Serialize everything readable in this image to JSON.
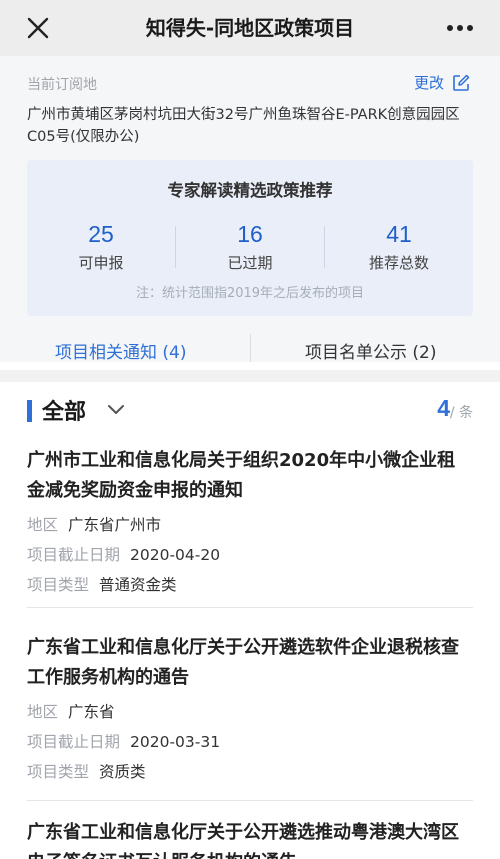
{
  "header": {
    "title": "知得失-同地区政策项目",
    "close_icon": "close-icon",
    "more_icon": "more-horizontal-icon"
  },
  "subscription": {
    "label": "当前订阅地",
    "change_label": "更改",
    "address": "广州市黄埔区茅岗村坑田大街32号广州鱼珠智谷E-PARK创意园园区C05号(仅限办公)"
  },
  "summary": {
    "title": "专家解读精选政策推荐",
    "stats": [
      {
        "value": "25",
        "label": "可申报"
      },
      {
        "value": "16",
        "label": "已过期"
      },
      {
        "value": "41",
        "label": "推荐总数"
      }
    ],
    "note": "注：统计范围指2019年之后发布的项目"
  },
  "tabs": [
    {
      "label": "项目相关通知 (4)",
      "active": true
    },
    {
      "label": "项目名单公示 (2)",
      "active": false
    }
  ],
  "filter": {
    "label": "全部",
    "count": "4",
    "unit": "/ 条"
  },
  "items": [
    {
      "title": "广州市工业和信息化局关于组织2020年中小微企业租金减免奖励资金申报的通知",
      "region_key": "地区",
      "region": "广东省广州市",
      "deadline_key": "项目截止日期",
      "deadline": "2020-04-20",
      "type_key": "项目类型",
      "type": "普通资金类"
    },
    {
      "title": "广东省工业和信息化厅关于公开遴选软件企业退税核查工作服务机构的通告",
      "region_key": "地区",
      "region": "广东省",
      "deadline_key": "项目截止日期",
      "deadline": "2020-03-31",
      "type_key": "项目类型",
      "type": "资质类"
    },
    {
      "title": "广东省工业和信息化厅关于公开遴选推动粤港澳大湾区电子签名证书互认服务机构的通告"
    }
  ],
  "colors": {
    "accent": "#2f6fd8",
    "header_bg": "#ededed",
    "card_bg": "#e9eef8"
  }
}
